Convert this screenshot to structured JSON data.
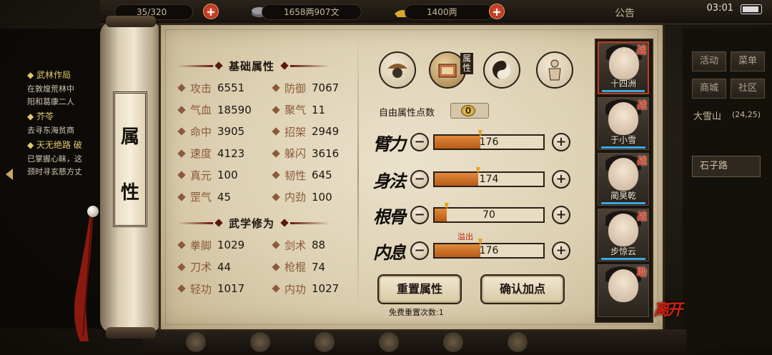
{
  "topbar": {
    "stamina": "35/320",
    "copper": "1658两907文",
    "silver": "1400两",
    "announcement": "公告",
    "time": "03:01"
  },
  "quests": [
    {
      "title": "武林作局",
      "desc": "在敦煌荒林中"
    },
    {
      "title": "",
      "desc": "阳和葛康二人"
    },
    {
      "title": "芥苓",
      "desc": "去寻东海贫商"
    },
    {
      "title": "天无绝路 破",
      "desc": "已掌握心眛，这"
    },
    {
      "title": "",
      "desc": "颈时寻玄慈方丈"
    }
  ],
  "scroll_title": [
    "属",
    "性"
  ],
  "basic_section_title": "基础属性",
  "basic_stats": [
    {
      "label": "攻击",
      "value": "6551"
    },
    {
      "label": "防御",
      "value": "7067"
    },
    {
      "label": "气血",
      "value": "18590"
    },
    {
      "label": "聚气",
      "value": "11"
    },
    {
      "label": "命中",
      "value": "3905"
    },
    {
      "label": "招架",
      "value": "2949"
    },
    {
      "label": "速度",
      "value": "4123"
    },
    {
      "label": "躲闪",
      "value": "3616"
    },
    {
      "label": "真元",
      "value": "100"
    },
    {
      "label": "韧性",
      "value": "645"
    },
    {
      "label": "罡气",
      "value": "45"
    },
    {
      "label": "内劲",
      "value": "100"
    }
  ],
  "martial_section_title": "武学修为",
  "martial_stats": [
    {
      "label": "拳脚",
      "value": "1029"
    },
    {
      "label": "剑术",
      "value": "88"
    },
    {
      "label": "刀术",
      "value": "44"
    },
    {
      "label": "枪棍",
      "value": "74"
    },
    {
      "label": "轻功",
      "value": "1017"
    },
    {
      "label": "内功",
      "value": "1027"
    }
  ],
  "tab_attr_label": "属性",
  "free_points": {
    "label": "自由属性点数",
    "value": "0"
  },
  "attributes": [
    {
      "name": "臂力",
      "value": "176",
      "fill": 0.42
    },
    {
      "name": "身法",
      "value": "174",
      "fill": 0.4
    },
    {
      "name": "根骨",
      "value": "70",
      "fill": 0.11
    },
    {
      "name": "内息",
      "value": "176",
      "fill": 0.42
    }
  ],
  "overflow_label": "溢出",
  "buttons": {
    "reset": "重置属性",
    "confirm": "确认加点"
  },
  "free_reset": "免费重置次数:1",
  "characters": [
    {
      "name": "十四洲",
      "badge": "战"
    },
    {
      "name": "于小雪",
      "badge": "战"
    },
    {
      "name": "蔺昊乾",
      "badge": "战"
    },
    {
      "name": "步惊云",
      "badge": "战"
    },
    {
      "name": "",
      "badge": "助"
    }
  ],
  "leave": "离开",
  "right_panel": {
    "buttons": [
      "活动",
      "菜单",
      "商城",
      "社区"
    ],
    "location": "大雪山",
    "coords": "(24,25)",
    "road": "石子路"
  },
  "colors": {
    "accent_red": "#c02010",
    "bar_fill": "#e08a3a",
    "parchment": "#e4d9bf"
  }
}
